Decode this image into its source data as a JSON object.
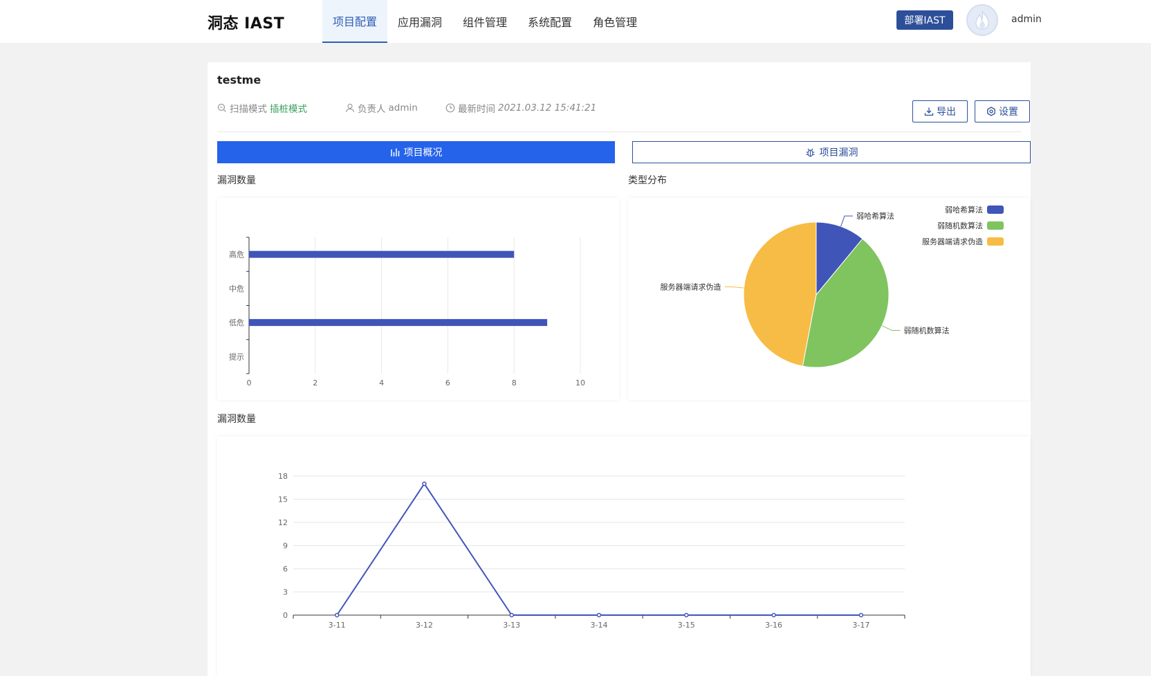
{
  "header": {
    "logo": "洞态 IAST",
    "nav": [
      "项目配置",
      "应用漏洞",
      "组件管理",
      "系统配置",
      "角色管理"
    ],
    "deploy_label": "部署IAST",
    "username": "admin"
  },
  "project": {
    "name": "testme",
    "scan_mode_label": "扫描模式",
    "scan_mode_value": "插桩模式",
    "owner_label": "负责人",
    "owner_value": "admin",
    "time_label": "最新时间",
    "time_value": "2021.03.12 15:41:21",
    "export_label": "导出",
    "settings_label": "设置"
  },
  "tabs": {
    "overview": "项目概况",
    "vulns": "项目漏洞"
  },
  "sections": {
    "bar_title": "漏洞数量",
    "pie_title": "类型分布",
    "line_title": "漏洞数量"
  },
  "colors": {
    "primary": "#2563eb",
    "brand": "#2d4f99",
    "bar": "#4055b8",
    "pie": [
      "#4055b8",
      "#7fc45f",
      "#f7bc45"
    ]
  },
  "chart_data": [
    {
      "type": "bar",
      "orientation": "horizontal",
      "categories": [
        "高危",
        "中危",
        "低危",
        "提示"
      ],
      "values": [
        8,
        0,
        9,
        0
      ],
      "xlim": [
        0,
        10
      ],
      "xticks": [
        0,
        2,
        4,
        6,
        8,
        10
      ],
      "grid": true
    },
    {
      "type": "pie",
      "labels": [
        "弱哈希算法",
        "弱随机数算法",
        "服务器端请求伪造"
      ],
      "values": [
        11,
        42,
        47
      ],
      "legend": "top-right"
    },
    {
      "type": "line",
      "x": [
        "3-11",
        "3-12",
        "3-13",
        "3-14",
        "3-15",
        "3-16",
        "3-17"
      ],
      "values": [
        0,
        17,
        0,
        0,
        0,
        0,
        0
      ],
      "ylim": [
        0,
        18
      ],
      "yticks": [
        0,
        3,
        6,
        9,
        12,
        15,
        18
      ],
      "grid": true
    }
  ]
}
